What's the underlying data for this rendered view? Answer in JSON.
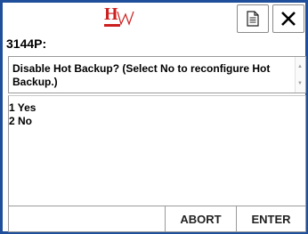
{
  "header": {
    "logo": {
      "letter": "H",
      "icon": "hw-logo-icon"
    },
    "doc_icon": "document-icon",
    "close_icon": "close-icon",
    "title": "3144P:"
  },
  "prompt": {
    "text": "Disable Hot Backup? (Select No to reconfigure Hot Backup.)"
  },
  "options": [
    {
      "label": "1 Yes"
    },
    {
      "label": "2 No"
    }
  ],
  "buttons": {
    "abort": "ABORT",
    "enter": "ENTER"
  },
  "colors": {
    "frame": "#1f4f9a",
    "logo": "#cc1f1f"
  }
}
